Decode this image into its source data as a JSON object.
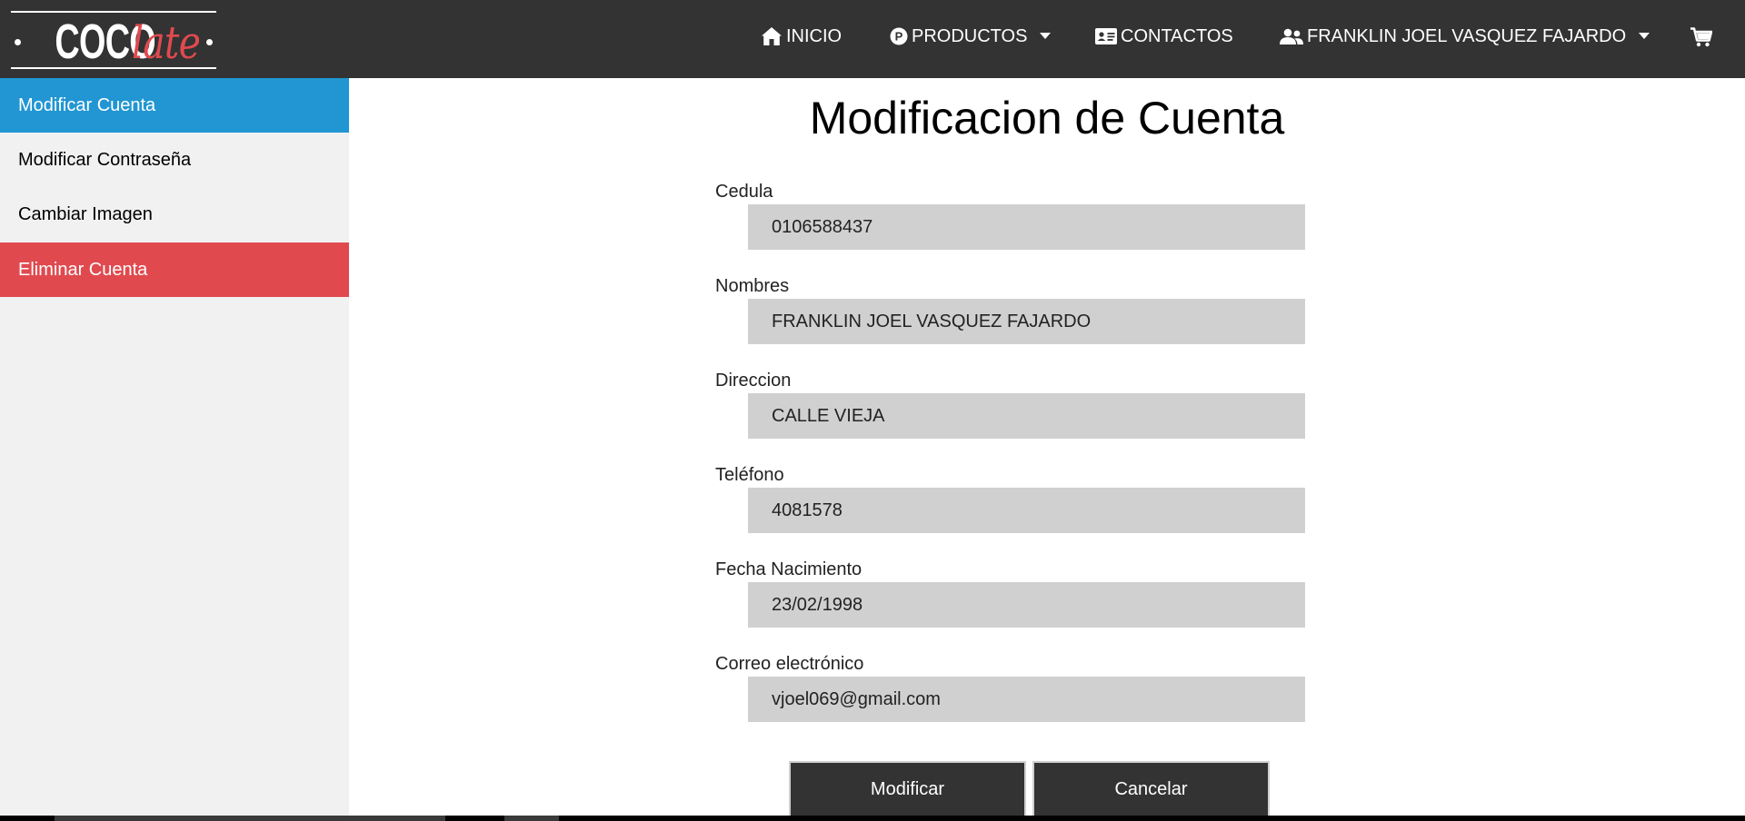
{
  "brand": {
    "logo_part1": "COCO",
    "logo_part2": "late",
    "accent_color": "#e04a4f"
  },
  "navbar": {
    "items": [
      {
        "label": "INICIO",
        "icon": "home-icon"
      },
      {
        "label": "PRODUCTOS",
        "icon": "p-circle-icon",
        "dropdown": true
      },
      {
        "label": "CONTACTOS",
        "icon": "id-card-icon"
      },
      {
        "label": "FRANKLIN JOEL VASQUEZ FAJARDO",
        "icon": "users-icon",
        "dropdown": true
      }
    ],
    "cart_icon": "cart-icon",
    "background": "#333333"
  },
  "sidebar": {
    "items": [
      {
        "label": "Modificar Cuenta",
        "state": "active",
        "color": "#2196d3"
      },
      {
        "label": "Modificar Contraseña",
        "state": "normal"
      },
      {
        "label": "Cambiar Imagen",
        "state": "normal"
      },
      {
        "label": "Eliminar Cuenta",
        "state": "danger",
        "color": "#e04a4f"
      }
    ]
  },
  "main": {
    "title": "Modificacion de Cuenta",
    "fields": [
      {
        "label": "Cedula",
        "value": "0106588437"
      },
      {
        "label": "Nombres",
        "value": "FRANKLIN JOEL VASQUEZ FAJARDO"
      },
      {
        "label": "Direccion",
        "value": "CALLE VIEJA"
      },
      {
        "label": "Teléfono",
        "value": "4081578"
      },
      {
        "label": "Fecha Nacimiento",
        "value": "23/02/1998"
      },
      {
        "label": "Correo electrónico",
        "value": "vjoel069@gmail.com"
      }
    ],
    "buttons": {
      "submit": "Modificar",
      "cancel": "Cancelar"
    }
  }
}
